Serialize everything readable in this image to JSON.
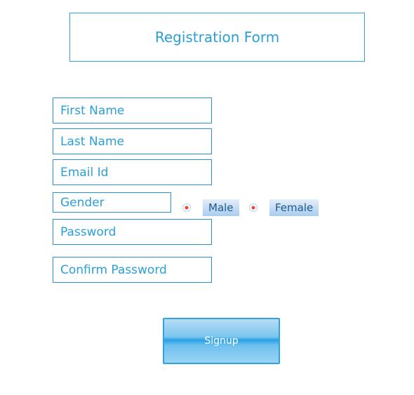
{
  "title": "Registration Form",
  "fields": {
    "first_name": "First Name",
    "last_name": "Last Name",
    "email": "Email Id",
    "gender": "Gender",
    "password": "Password",
    "confirm_password": "Confirm Password"
  },
  "gender_options": [
    "Male",
    "Female"
  ],
  "signup_label": "Signup"
}
